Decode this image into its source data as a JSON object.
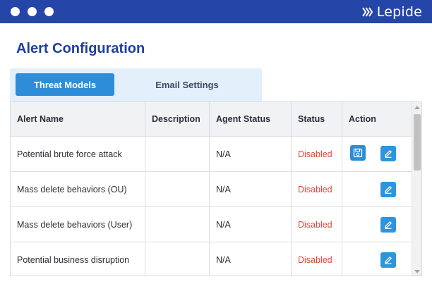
{
  "window": {
    "brand_name": "Lepide",
    "controls": [
      "close-dot",
      "minimize-dot",
      "maximize-dot"
    ]
  },
  "page": {
    "title": "Alert Configuration"
  },
  "tabs": [
    {
      "label": "Threat Models",
      "active": true
    },
    {
      "label": "Email Settings",
      "active": false
    }
  ],
  "table": {
    "columns": [
      "Alert Name",
      "Description",
      "Agent Status",
      "Status",
      "Action"
    ],
    "rows": [
      {
        "alert_name": "Potential brute force attack",
        "description": "",
        "agent_status": "N/A",
        "status": "Disabled",
        "actions": [
          "save-icon",
          "edit-icon"
        ]
      },
      {
        "alert_name": "Mass delete behaviors (OU)",
        "description": "",
        "agent_status": "N/A",
        "status": "Disabled",
        "actions": [
          "edit-icon"
        ]
      },
      {
        "alert_name": "Mass delete behaviors (User)",
        "description": "",
        "agent_status": "N/A",
        "status": "Disabled",
        "actions": [
          "edit-icon"
        ]
      },
      {
        "alert_name": "Potential business disruption",
        "description": "",
        "agent_status": "N/A",
        "status": "Disabled",
        "actions": [
          "edit-icon"
        ]
      }
    ]
  },
  "colors": {
    "titlebar": "#2546a8",
    "page_title": "#1f3f9c",
    "tab_active": "#2d8dd8",
    "tabbar_bg": "#e3effb",
    "status_disabled": "#e0463b",
    "action_button": "#2d95dd"
  }
}
